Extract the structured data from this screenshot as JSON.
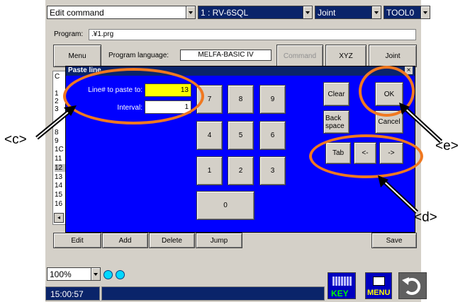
{
  "top": {
    "command_combo": "Edit command",
    "robot_combo": "1 : RV-6SQL",
    "mode_combo": "Joint",
    "tool_combo": "TOOL0"
  },
  "program": {
    "label": "Program:",
    "value": ".¥1.prg"
  },
  "toolbar": {
    "menu": "Menu",
    "language_label": "Program language:",
    "language_value": "MELFA-BASIC IV",
    "command": "Command",
    "xyz": "XYZ",
    "joint": "Joint"
  },
  "listing": {
    "header": "C",
    "lines": [
      "1",
      "2",
      "3",
      "8",
      "9",
      "1C",
      "11",
      "12",
      "13",
      "14",
      "15",
      "16"
    ]
  },
  "dialog": {
    "title": "Paste line",
    "close": "×",
    "line_label": "Line# to paste to:",
    "line_value": "13",
    "interval_label": "Interval:",
    "interval_value": "1",
    "keys": [
      "7",
      "8",
      "9",
      "4",
      "5",
      "6",
      "1",
      "2",
      "3",
      "0"
    ],
    "clear": "Clear",
    "ok": "OK",
    "backspace": "Back space",
    "cancel": "Cancel",
    "tab": "Tab",
    "left": "<-",
    "right": "->"
  },
  "bottom_buttons": {
    "edit": "Edit",
    "add": "Add",
    "delete": "Delete",
    "jump": "Jump",
    "save": "Save"
  },
  "status": {
    "zoom": "100%",
    "time": "15:00:57"
  },
  "side_icons": {
    "key_label": "KEY",
    "menu_label": "MENU"
  },
  "callouts": {
    "c": "<c>",
    "d": "<d>",
    "e": "<e>"
  },
  "colors": {
    "dialog_blue": "#0000ff",
    "title_navy": "#0a246a",
    "highlight_yellow": "#ffff00",
    "annotation_orange": "#f07820",
    "indicator_cyan": "#00d8ff"
  }
}
